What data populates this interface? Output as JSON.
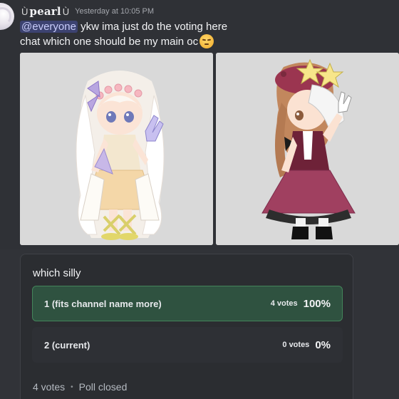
{
  "message": {
    "author": "pearl",
    "author_decoration_left": "ა",
    "author_decoration_right": "ઉ",
    "timestamp": "Yesterday at 10:05 PM",
    "mention": "@everyone",
    "line1_rest": " ykw ima just do the voting here",
    "line2": "chat which one should be my main oc",
    "emoji": "relieved-face-icon"
  },
  "attachments": [
    {
      "name": "oc-1-image",
      "description": "white-haired gacha oc"
    },
    {
      "name": "oc-2-image",
      "description": "brown-haired gacha oc with beret"
    }
  ],
  "poll": {
    "question": "which silly",
    "answers": [
      {
        "label": "1 (fits channel name more)",
        "votes": "4 votes",
        "percent": "100%",
        "fraction": 1.0,
        "winner": true
      },
      {
        "label": "2 (current)",
        "votes": "0 votes",
        "percent": "0%",
        "fraction": 0.0,
        "winner": false
      }
    ],
    "total_votes": "4 votes",
    "status": "Poll closed",
    "separator": "•"
  },
  "colors": {
    "background": "#313338",
    "mention_bg": "#3c4270",
    "winner_bg": "#2f5240",
    "winner_border": "#43855a"
  }
}
